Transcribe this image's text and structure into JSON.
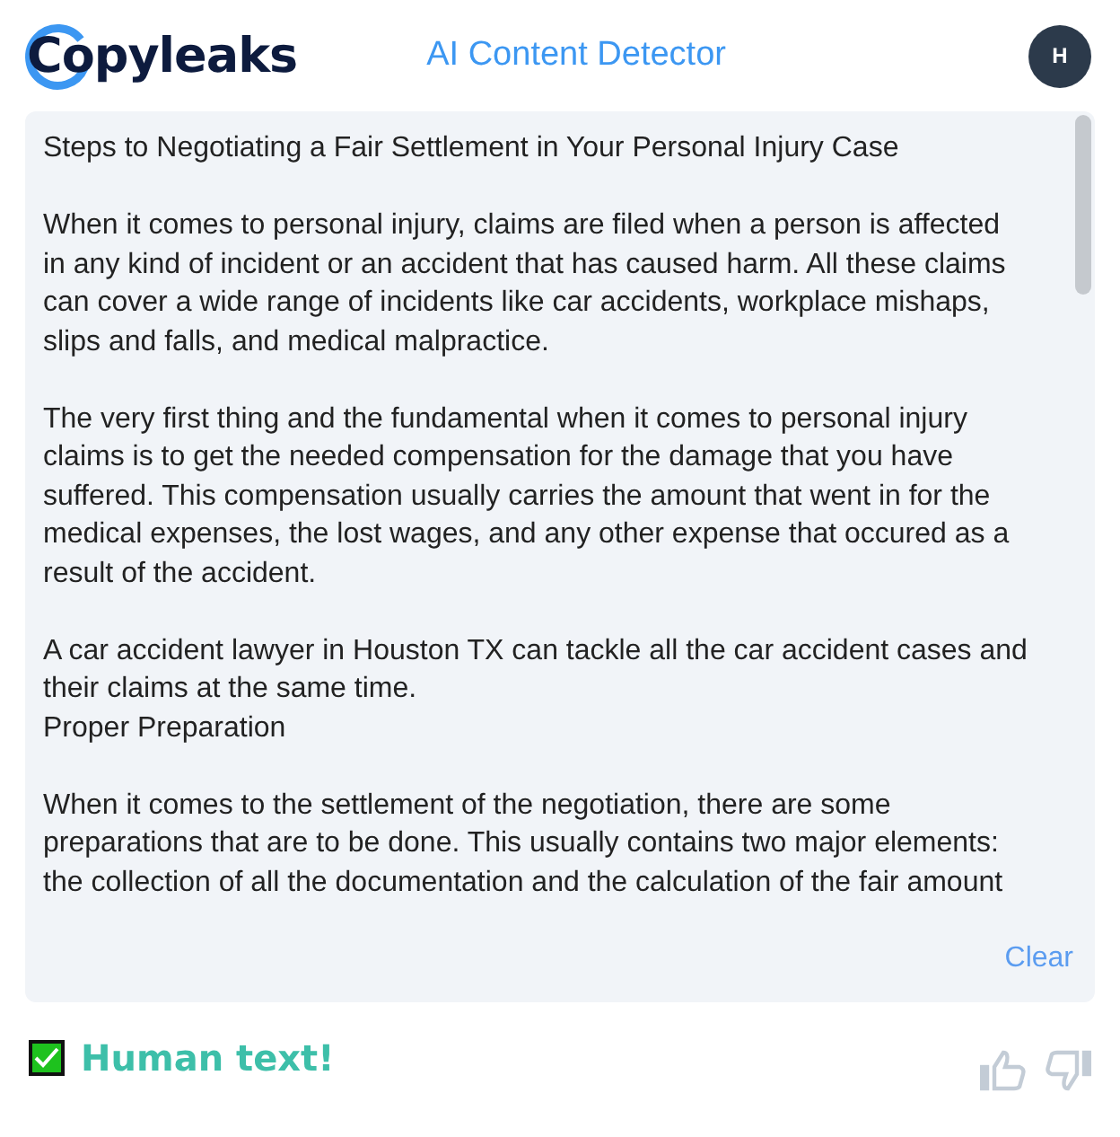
{
  "header": {
    "logo": "Copyleaks",
    "title": "AI Content Detector",
    "avatar": "H"
  },
  "document": {
    "paragraphs": [
      {
        "kind": "text",
        "lines": [
          "Steps to Negotiating a Fair Settlement in Your Personal Injury Case"
        ]
      },
      {
        "kind": "text",
        "lines": [
          "When it comes to personal injury, claims are filed when a person is affected",
          "in any kind of incident or an accident that has caused harm. All these claims",
          "can cover a wide range of incidents like car accidents, workplace mishaps,",
          "slips and falls, and medical malpractice."
        ]
      },
      {
        "kind": "text",
        "lines": [
          "The very first thing and the fundamental when it comes to personal injury",
          "claims is to get the needed compensation for the damage that you have",
          "suffered. This compensation usually carries the amount that went in for the",
          "medical expenses, the lost wages, and any other expense that occured as a",
          "result of the accident."
        ]
      },
      {
        "kind": "text",
        "lines": [
          "A car accident lawyer in Houston TX can tackle all the car accident cases and",
          "their claims at the same time."
        ]
      },
      {
        "kind": "heading",
        "lines": [
          "Proper Preparation"
        ]
      },
      {
        "kind": "text",
        "lines": [
          "When it comes to the settlement of the negotiation, there are some",
          "preparations that are to be done. This usually contains two major elements:",
          "the collection of all the documentation and the calculation of the fair amount"
        ]
      }
    ],
    "clear": "Clear"
  },
  "result": {
    "checked": true,
    "label": "Human text!"
  }
}
